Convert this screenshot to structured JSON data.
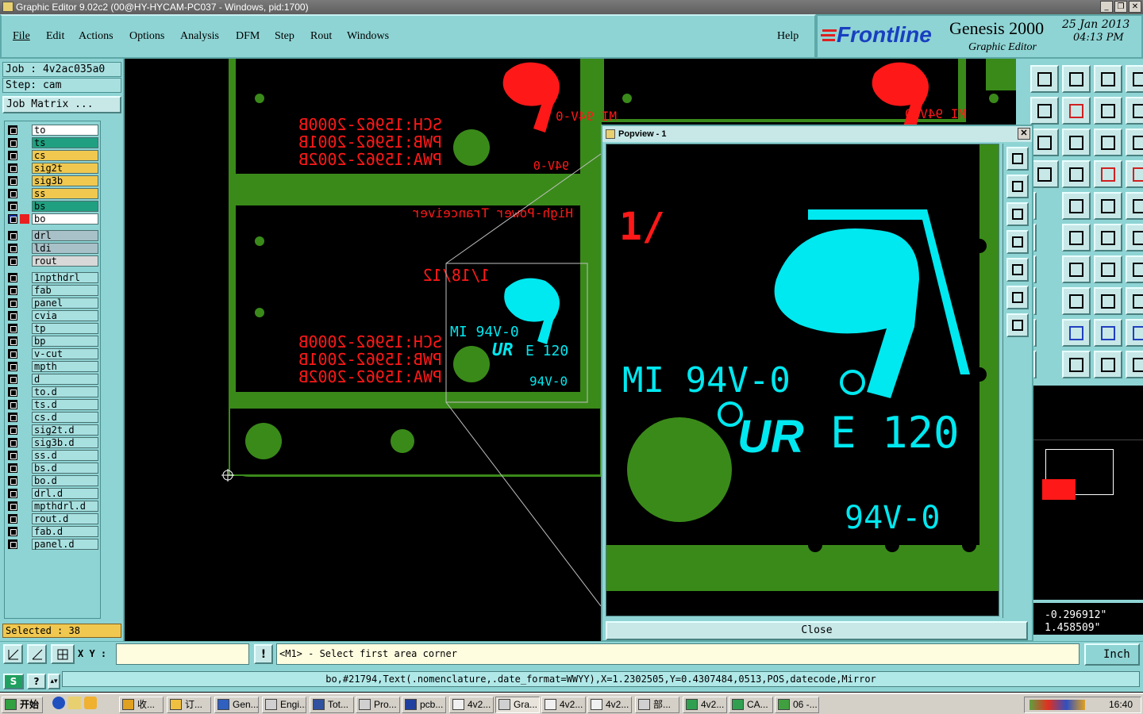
{
  "window": {
    "title": "Graphic Editor 9.02c2 (00@HY-HYCAM-PC037 - Windows, pid:1700)"
  },
  "menu": {
    "items": [
      "File",
      "Edit",
      "Actions",
      "Options",
      "Analysis",
      "DFM",
      "Step",
      "Rout",
      "Windows"
    ],
    "help": "Help"
  },
  "brand": {
    "logo": "Frontline",
    "product": "Genesis 2000",
    "subtitle": "Graphic Editor",
    "date": "25 Jan 2013",
    "time": "04:13 PM"
  },
  "job": {
    "job_label": "Job : 4v2ac035a0",
    "step_label": "Step: cam",
    "matrix_button": "Job Matrix ..."
  },
  "layers": [
    {
      "name": "to",
      "color": "#ffffff"
    },
    {
      "name": "ts",
      "color": "#20a080"
    },
    {
      "name": "cs",
      "color": "#f0c850"
    },
    {
      "name": "sig2t",
      "color": "#f0c850"
    },
    {
      "name": "sig3b",
      "color": "#f0c850"
    },
    {
      "name": "ss",
      "color": "#f0c850"
    },
    {
      "name": "bs",
      "color": "#20a080"
    },
    {
      "name": "bo",
      "color": "#ffffff"
    },
    {
      "name": "drl",
      "color": "#a8c0c8"
    },
    {
      "name": "ldi",
      "color": "#a8c0c8"
    },
    {
      "name": "rout",
      "color": "#d8d8d8"
    },
    {
      "name": "1npthdrl",
      "color": "#a8e0e0"
    },
    {
      "name": "fab",
      "color": "#a8e0e0"
    },
    {
      "name": "panel",
      "color": "#a8e0e0"
    },
    {
      "name": "cvia",
      "color": "#a8e0e0"
    },
    {
      "name": "tp",
      "color": "#a8e0e0"
    },
    {
      "name": "bp",
      "color": "#a8e0e0"
    },
    {
      "name": "v-cut",
      "color": "#a8e0e0"
    },
    {
      "name": "mpth",
      "color": "#a8e0e0"
    },
    {
      "name": "d",
      "color": "#a8e0e0"
    },
    {
      "name": "to.d",
      "color": "#a8e0e0"
    },
    {
      "name": "ts.d",
      "color": "#a8e0e0"
    },
    {
      "name": "cs.d",
      "color": "#a8e0e0"
    },
    {
      "name": "sig2t.d",
      "color": "#a8e0e0"
    },
    {
      "name": "sig3b.d",
      "color": "#a8e0e0"
    },
    {
      "name": "ss.d",
      "color": "#a8e0e0"
    },
    {
      "name": "bs.d",
      "color": "#a8e0e0"
    },
    {
      "name": "bo.d",
      "color": "#a8e0e0"
    },
    {
      "name": "drl.d",
      "color": "#a8e0e0"
    },
    {
      "name": "mpthdrl.d",
      "color": "#a8e0e0"
    },
    {
      "name": "rout.d",
      "color": "#a8e0e0"
    },
    {
      "name": "fab.d",
      "color": "#a8e0e0"
    },
    {
      "name": "panel.d",
      "color": "#a8e0e0"
    }
  ],
  "selected": "Selected : 38",
  "canvas": {
    "schematic_lines": [
      "SCH:15962-2000B",
      "PWB:15962-2001B",
      "PWA:15962-2002B"
    ],
    "tranceiver": "High-Power Tranceiver",
    "date_code": "1/18/12",
    "marking_mi": "MI 94V-0",
    "marking_e": "E 120",
    "marking_94": "94V-0",
    "ur": "UR"
  },
  "popview": {
    "title": "Popview - 1",
    "close_label": "Close",
    "fragment": "1/"
  },
  "coords": {
    "x": "-0.296912\"",
    "y": "1.458509\""
  },
  "command": {
    "xy_label": "X Y :",
    "xy_value": "",
    "prompt": "<M1> - Select first area corner",
    "units": "Inch"
  },
  "status": {
    "text": "bo,#21794,Text(.nomenclature,.date_format=WWYY),X=1.2302505,Y=0.4307484,0513,POS,datecode,Mirror"
  },
  "taskbar": {
    "start": "开始",
    "tasks": [
      "收...",
      "订...",
      "Gen...",
      "Engi...",
      "Tot...",
      "Pro...",
      "pcb...",
      "4v2...",
      "Gra...",
      "4v2...",
      "4v2...",
      "部...",
      "4v2...",
      "CA...",
      "06 -..."
    ],
    "clock": "16:40"
  },
  "colors": {
    "panel": "#8fd4d4",
    "copper": "#3a8a1a",
    "silk_red": "#ff1818",
    "silk_cyan": "#00e8f0"
  }
}
